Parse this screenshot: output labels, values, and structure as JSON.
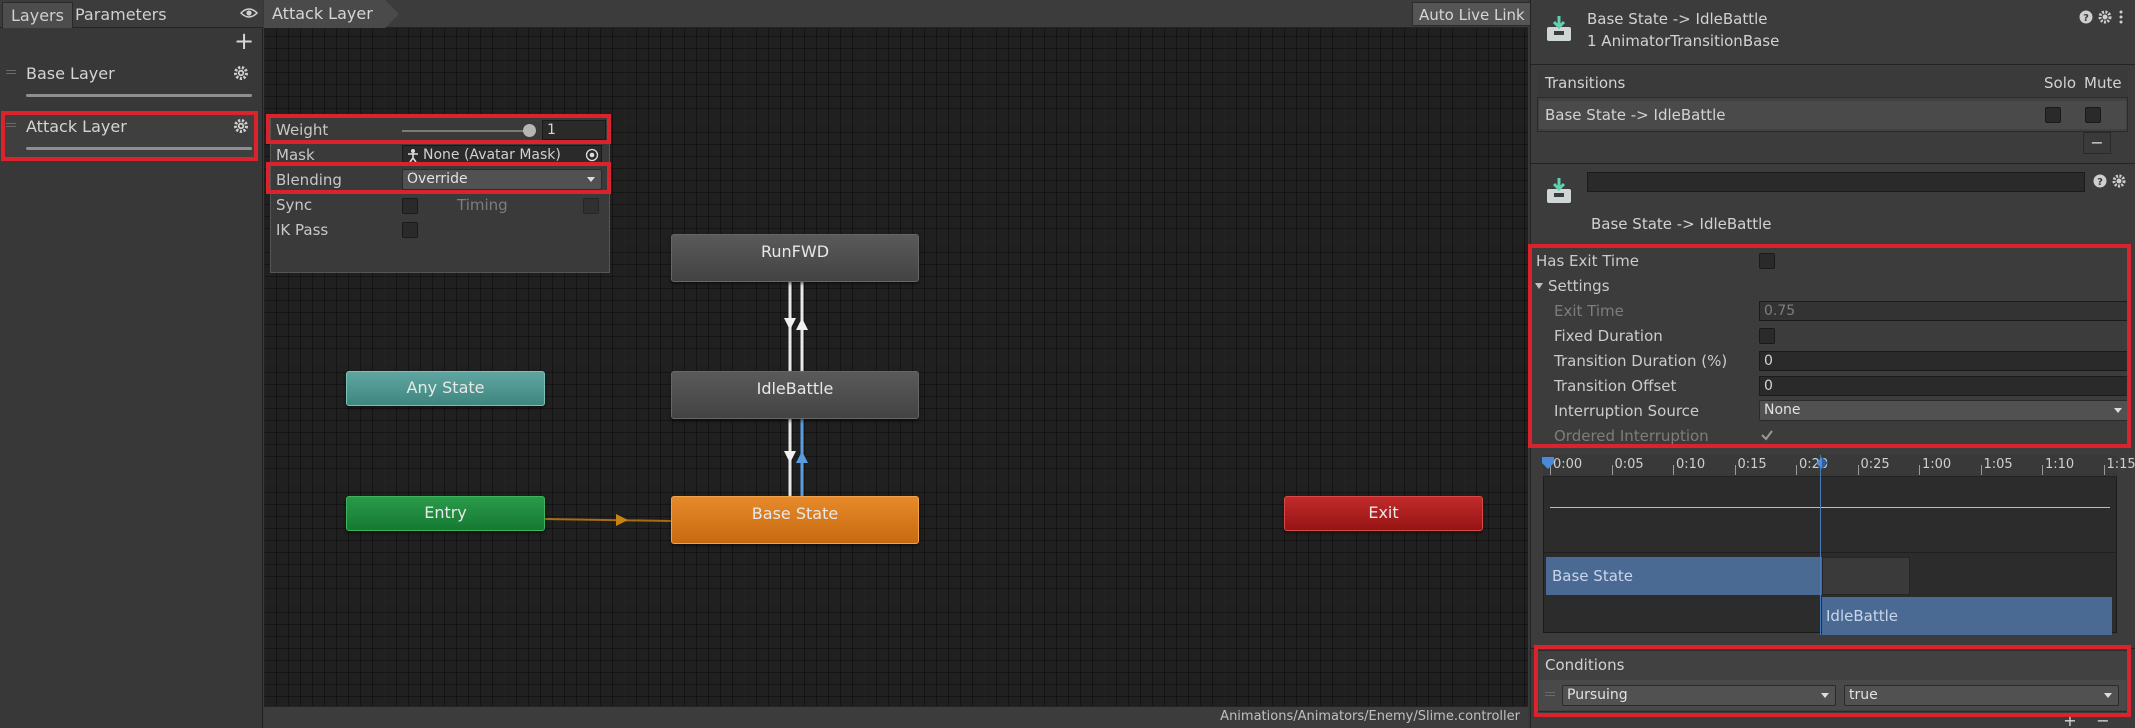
{
  "left_panel": {
    "tabs": [
      "Layers",
      "Parameters"
    ],
    "layers": [
      {
        "name": "Base Layer"
      },
      {
        "name": "Attack Layer"
      }
    ]
  },
  "graph": {
    "breadcrumb": "Attack Layer",
    "auto_live_link": "Auto Live Link",
    "controller_path": "Animations/Animators/Enemy/Slime.controller",
    "layer_settings": {
      "weight_label": "Weight",
      "weight_value": "1",
      "mask_label": "Mask",
      "mask_value": "None (Avatar Mask)",
      "blending_label": "Blending",
      "blending_value": "Override",
      "sync_label": "Sync",
      "timing_label": "Timing",
      "ik_pass_label": "IK Pass"
    },
    "states": {
      "runfwd": "RunFWD",
      "idlebattle": "IdleBattle",
      "base_state": "Base State",
      "any_state": "Any State",
      "entry": "Entry",
      "exit": "Exit"
    }
  },
  "inspector": {
    "title": "Base State -> IdleBattle",
    "subtitle": "1 AnimatorTransitionBase",
    "transitions_header": "Transitions",
    "solo_label": "Solo",
    "mute_label": "Mute",
    "transition_row": "Base State -> IdleBattle",
    "minus": "−",
    "transition_name": "Base State -> IdleBattle",
    "has_exit_time_label": "Has Exit Time",
    "settings_label": "Settings",
    "exit_time_label": "Exit Time",
    "exit_time_value": "0.75",
    "fixed_duration_label": "Fixed Duration",
    "transition_duration_label": "Transition Duration (%)",
    "transition_duration_value": "0",
    "transition_offset_label": "Transition Offset",
    "transition_offset_value": "0",
    "interruption_source_label": "Interruption Source",
    "interruption_source_value": "None",
    "ordered_interruption_label": "Ordered Interruption",
    "timeline": {
      "ticks": [
        "0:00",
        "0:05",
        "0:10",
        "0:15",
        "0:20",
        "0:25",
        "1:00",
        "1:05",
        "1:10",
        "1:15"
      ],
      "clip_source": "Base State",
      "clip_target": "IdleBattle"
    },
    "conditions_label": "Conditions",
    "condition_parameter": "Pursuing",
    "condition_value": "true",
    "plus": "+",
    "minus2": "−"
  }
}
